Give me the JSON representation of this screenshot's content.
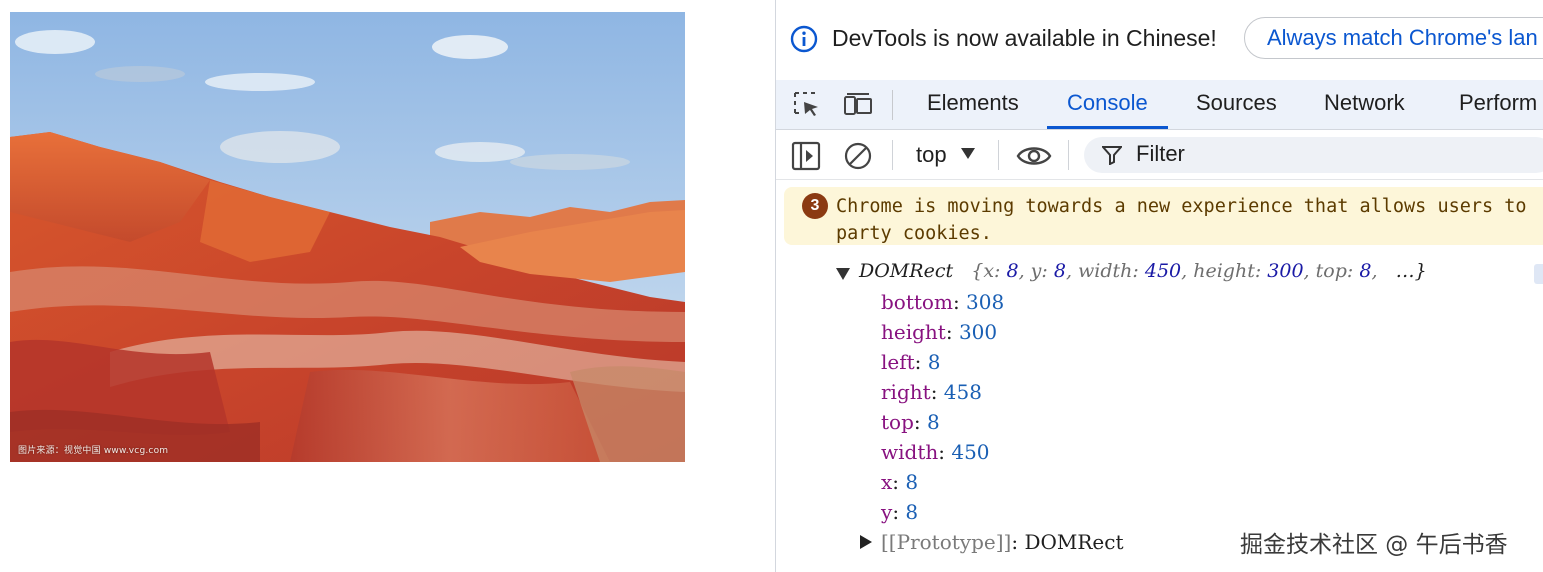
{
  "page": {
    "photo": {
      "alt": "",
      "watermark": "图片来源：视觉中国 www.vcg.com"
    }
  },
  "devtools": {
    "notice": {
      "text": "DevTools is now available in Chinese!",
      "button_label": "Always match Chrome's lan",
      "icon": "info-icon"
    },
    "toolbar_icons": [
      "inspect-element-icon",
      "device-toolbar-icon"
    ],
    "tabs": [
      {
        "label": "Elements",
        "active": false
      },
      {
        "label": "Console",
        "active": true
      },
      {
        "label": "Sources",
        "active": false
      },
      {
        "label": "Network",
        "active": false
      },
      {
        "label": "Perform",
        "active": false
      }
    ],
    "console_toolbar": {
      "context": "top",
      "filter_placeholder": "Filter",
      "icons": [
        "sidebar-toggle-icon",
        "clear-console-icon",
        "eye-icon",
        "filter-icon"
      ]
    },
    "warning": {
      "count": "3",
      "text_line1": "Chrome is moving towards a new experience that allows users to",
      "text_line2": "party cookies."
    },
    "object": {
      "type": "DOMRect",
      "summary": {
        "x_key": "x",
        "x_val": "8",
        "y_key": "y",
        "y_val": "8",
        "width_key": "width",
        "width_val": "450",
        "height_key": "height",
        "height_val": "300",
        "top_key": "top",
        "top_val": "8",
        "ellipsis": "…}"
      },
      "properties": [
        {
          "key": "bottom",
          "value": "308"
        },
        {
          "key": "height",
          "value": "300"
        },
        {
          "key": "left",
          "value": "8"
        },
        {
          "key": "right",
          "value": "458"
        },
        {
          "key": "top",
          "value": "8"
        },
        {
          "key": "width",
          "value": "450"
        },
        {
          "key": "x",
          "value": "8"
        },
        {
          "key": "y",
          "value": "8"
        }
      ],
      "prototype_key": "[[Prototype]]",
      "prototype_val": "DOMRect"
    },
    "colors": {
      "accent": "#0b57d0",
      "warning_bg": "#fdf6d9",
      "badge": "#8b3a12",
      "prop_key": "#881280",
      "prop_val": "#1a5fb4"
    }
  },
  "site_watermark": "掘金技术社区 @ 午后书香"
}
